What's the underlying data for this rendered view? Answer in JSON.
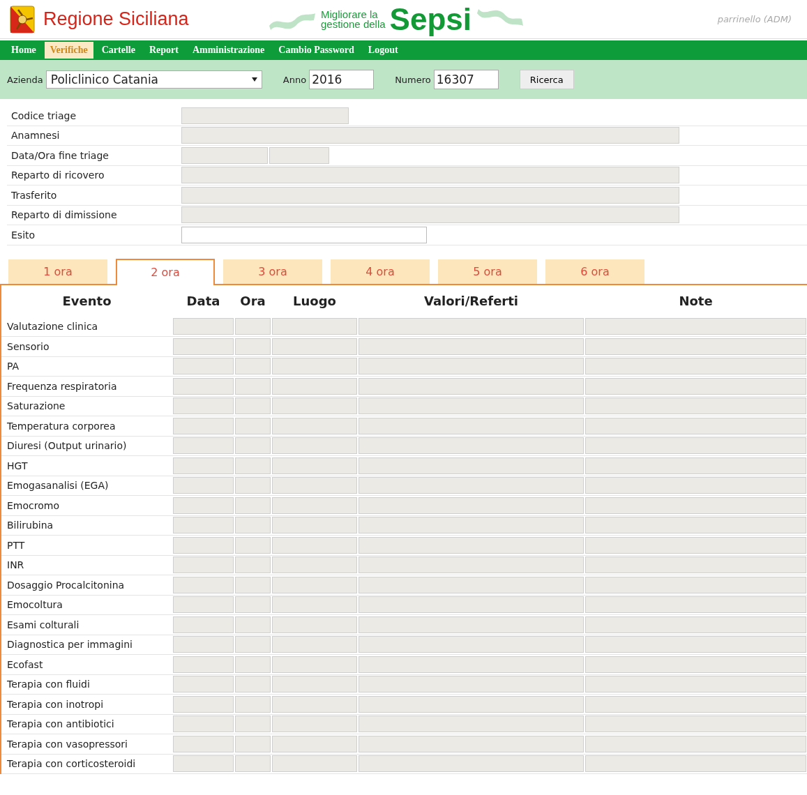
{
  "header": {
    "region": "Regione Siciliana",
    "tagline_top": "Migliorare la",
    "tagline_bottom": "gestione della",
    "logo_word": "Sepsi",
    "user": "parrinello (ADM)"
  },
  "nav": [
    {
      "label": "Home",
      "selected": false
    },
    {
      "label": "Verifiche",
      "selected": true
    },
    {
      "label": "Cartelle",
      "selected": false
    },
    {
      "label": "Report",
      "selected": false
    },
    {
      "label": "Amministrazione",
      "selected": false
    },
    {
      "label": "Cambio Password",
      "selected": false
    },
    {
      "label": "Logout",
      "selected": false
    }
  ],
  "filter": {
    "azienda_label": "Azienda",
    "azienda_value": "Policlinico Catania",
    "anno_label": "Anno",
    "anno_value": "2016",
    "numero_label": "Numero",
    "numero_value": "16307",
    "button": "Ricerca"
  },
  "form": [
    {
      "label": "Codice triage",
      "kind": "short",
      "disabled": true
    },
    {
      "label": "Anamnesi",
      "kind": "wide",
      "disabled": true
    },
    {
      "label": "Data/Ora fine triage",
      "kind": "datetime",
      "disabled": true
    },
    {
      "label": "Reparto di ricovero",
      "kind": "wide",
      "disabled": true
    },
    {
      "label": "Trasferito",
      "kind": "wide",
      "disabled": true
    },
    {
      "label": "Reparto di dimissione",
      "kind": "wide",
      "disabled": true
    },
    {
      "label": "Esito",
      "kind": "medium",
      "disabled": false
    }
  ],
  "tabs": [
    {
      "label": "1 ora",
      "selected": false
    },
    {
      "label": "2 ora",
      "selected": true
    },
    {
      "label": "3 ora",
      "selected": false
    },
    {
      "label": "4 ora",
      "selected": false
    },
    {
      "label": "5 ora",
      "selected": false
    },
    {
      "label": "6 ora",
      "selected": false
    }
  ],
  "table": {
    "columns": [
      "Evento",
      "Data",
      "Ora",
      "Luogo",
      "Valori/Referti",
      "Note"
    ],
    "rows": [
      "Valutazione clinica",
      "Sensorio",
      "PA",
      "Frequenza respiratoria",
      "Saturazione",
      "Temperatura corporea",
      "Diuresi (Output urinario)",
      "HGT",
      "Emogasanalisi (EGA)",
      "Emocromo",
      "Bilirubina",
      "PTT",
      "INR",
      "Dosaggio Procalcitonina",
      "Emocoltura",
      "Esami colturali",
      "Diagnostica per immagini",
      "Ecofast",
      "Terapia con fluidi",
      "Terapia con inotropi",
      "Terapia con antibiotici",
      "Terapia con vasopressori",
      "Terapia con corticosteroidi"
    ]
  }
}
